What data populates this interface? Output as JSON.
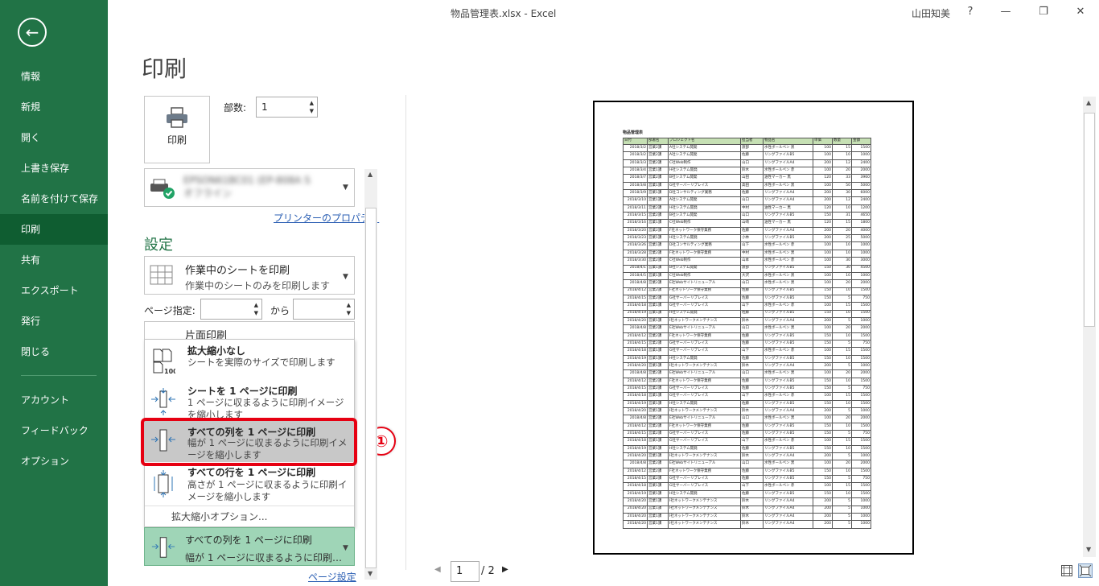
{
  "window": {
    "title": "物品管理表.xlsx  -  Excel",
    "user": "山田知美",
    "help": "?",
    "minimize": "—",
    "restore": "❐",
    "close": "✕"
  },
  "nav": {
    "back": "←",
    "items": [
      "情報",
      "新規",
      "開く",
      "上書き保存",
      "名前を付けて保存",
      "印刷",
      "共有",
      "エクスポート",
      "発行",
      "閉じる"
    ],
    "bottom_items": [
      "アカウント",
      "フィードバック",
      "オプション"
    ],
    "active": "印刷"
  },
  "print": {
    "heading": "印刷",
    "button_label": "印刷",
    "copies_label": "部数:",
    "copies_value": "1",
    "printer_name": "EPSON61BC01 (EP-808A S",
    "printer_status": "オフライン",
    "printer_properties": "プリンターのプロパティ"
  },
  "settings": {
    "heading": "設定",
    "what": {
      "title": "作業中のシートを印刷",
      "desc": "作業中のシートのみを印刷します"
    },
    "pages_label": "ページ指定:",
    "pages_to": "から",
    "sides": {
      "title": "片面印刷"
    },
    "scaling_menu": [
      {
        "title": "拡大縮小なし",
        "desc": "シートを実際のサイズで印刷します"
      },
      {
        "title": "シートを 1 ページに印刷",
        "desc": "1 ページに収まるように印刷イメージを縮小します"
      },
      {
        "title": "すべての列を 1 ページに印刷",
        "desc": "幅が 1 ページに収まるように印刷イメージを縮小します"
      },
      {
        "title": "すべての行を 1 ページに印刷",
        "desc": "高さが 1 ページに収まるように印刷イメージを縮小します"
      }
    ],
    "scaling_options": "拡大縮小オプション...",
    "scaling_selected": {
      "title": "すべての列を 1 ページに印刷",
      "desc": "幅が 1 ページに収まるように印刷…"
    },
    "page_setup": "ページ設定",
    "step_badge": "①"
  },
  "pager": {
    "prev": "◀",
    "current": "1",
    "total": "/ 2",
    "next": "▶"
  },
  "sheet": {
    "title": "物品管理表",
    "headers": [
      "日付",
      "部署名",
      "プロジェクト名",
      "担当者",
      "物品名",
      "単価",
      "数量",
      "金額"
    ],
    "rows": [
      [
        "2018/3/2",
        "営業2課",
        "A社システム開発",
        "渡部",
        "水性ボールペン 黒",
        "100",
        "15",
        "1500"
      ],
      [
        "2018/3/2",
        "営業2課",
        "A社システム開発",
        "佐藤",
        "リングファイルB5",
        "100",
        "10",
        "1000"
      ],
      [
        "2018/3/3",
        "営業2課",
        "C社Web制作",
        "山口",
        "リングファイルA4",
        "200",
        "12",
        "2400"
      ],
      [
        "2018/3/4",
        "営業1課",
        "H社システム開発",
        "鈴木",
        "水性ボールペン 赤",
        "100",
        "20",
        "2000"
      ],
      [
        "2018/3/7",
        "営業2課",
        "B社システム開発",
        "山田",
        "油性マーカー 黒",
        "120",
        "33",
        "3960"
      ],
      [
        "2018/3/8",
        "営業1課",
        "G社サーバーリプレイス",
        "高田",
        "水性ボールペン 黒",
        "100",
        "50",
        "5000"
      ],
      [
        "2018/3/9",
        "営業1課",
        "D社コンサルティング業務",
        "佐藤",
        "リングファイルA4",
        "200",
        "30",
        "6000"
      ],
      [
        "2018/3/10",
        "営業1課",
        "A社システム開発",
        "山口",
        "リングファイルA4",
        "200",
        "12",
        "2400"
      ],
      [
        "2018/3/11",
        "営業2課",
        "H社システム開発",
        "中村",
        "油性マーカー 黒",
        "120",
        "10",
        "1200"
      ],
      [
        "2018/3/15",
        "営業2課",
        "B社システム開発",
        "山口",
        "リングファイルB5",
        "150",
        "31",
        "4650"
      ],
      [
        "2018/3/16",
        "営業1課",
        "C社Web制作",
        "山崎",
        "油性マーカー 黒",
        "120",
        "15",
        "1800"
      ],
      [
        "2018/3/20",
        "営業2課",
        "F社ネットワーク保守業務",
        "佐藤",
        "リングファイルA4",
        "200",
        "20",
        "4000"
      ],
      [
        "2018/3/23",
        "営業1課",
        "H社システム開発",
        "小林",
        "リングファイルB5",
        "200",
        "25",
        "5000"
      ],
      [
        "2018/3/26",
        "営業1課",
        "D社コンサルティング業務",
        "山下",
        "水性ボールペン 赤",
        "100",
        "10",
        "1000"
      ],
      [
        "2018/3/28",
        "営業2課",
        "F社ネットワーク保守業務",
        "中村",
        "水性ボールペン 黒",
        "100",
        "10",
        "1000"
      ],
      [
        "2018/3/30",
        "営業2課",
        "C社Web制作",
        "山本",
        "水性ボールペン 赤",
        "100",
        "30",
        "3000"
      ],
      [
        "2018/4/1",
        "営業1課",
        "B社システム開発",
        "渡部",
        "リングファイルB5",
        "150",
        "30",
        "4500"
      ],
      [
        "2018/4/5",
        "営業1課",
        "C社Web制作",
        "大沢",
        "水性ボールペン 黒",
        "100",
        "10",
        "1000"
      ],
      [
        "2018/4/8",
        "営業2課",
        "E社Webサイトリニューアル",
        "山口",
        "水性ボールペン 黒",
        "100",
        "20",
        "2000"
      ],
      [
        "2018/4/12",
        "営業2課",
        "F社ネットワーク保守業務",
        "佐藤",
        "リングファイルB5",
        "150",
        "10",
        "1500"
      ],
      [
        "2018/4/15",
        "営業2課",
        "G社サーバーリプレイス",
        "佐藤",
        "リングファイルB5",
        "150",
        "5",
        "750"
      ],
      [
        "2018/4/18",
        "営業1課",
        "G社サーバーリプレイス",
        "山下",
        "水性ボールペン 赤",
        "100",
        "15",
        "1500"
      ],
      [
        "2018/4/19",
        "営業1課",
        "H社システム開発",
        "佐藤",
        "リングファイルB5",
        "150",
        "10",
        "1500"
      ],
      [
        "2018/4/20",
        "営業1課",
        "I社ネットワークメンテナンス",
        "鈴木",
        "リングファイルA4",
        "200",
        "5",
        "1000"
      ],
      [
        "2018/4/8",
        "営業2課",
        "E社Webサイトリニューアル",
        "山口",
        "水性ボールペン 黒",
        "100",
        "20",
        "2000"
      ],
      [
        "2018/4/12",
        "営業2課",
        "F社ネットワーク保守業務",
        "佐藤",
        "リングファイルB5",
        "150",
        "10",
        "1500"
      ],
      [
        "2018/4/15",
        "営業2課",
        "G社サーバーリプレイス",
        "佐藤",
        "リングファイルB5",
        "150",
        "5",
        "750"
      ],
      [
        "2018/4/18",
        "営業1課",
        "G社サーバーリプレイス",
        "山下",
        "水性ボールペン 赤",
        "100",
        "15",
        "1500"
      ],
      [
        "2018/4/19",
        "営業1課",
        "H社システム開発",
        "佐藤",
        "リングファイルB5",
        "150",
        "10",
        "1500"
      ],
      [
        "2018/4/20",
        "営業1課",
        "I社ネットワークメンテナンス",
        "鈴木",
        "リングファイルA4",
        "200",
        "5",
        "1000"
      ],
      [
        "2018/4/8",
        "営業2課",
        "E社Webサイトリニューアル",
        "山口",
        "水性ボールペン 黒",
        "100",
        "20",
        "2000"
      ],
      [
        "2018/4/12",
        "営業2課",
        "F社ネットワーク保守業務",
        "佐藤",
        "リングファイルB5",
        "150",
        "10",
        "1500"
      ],
      [
        "2018/4/15",
        "営業2課",
        "G社サーバーリプレイス",
        "佐藤",
        "リングファイルB5",
        "150",
        "5",
        "750"
      ],
      [
        "2018/4/18",
        "営業1課",
        "G社サーバーリプレイス",
        "山下",
        "水性ボールペン 赤",
        "100",
        "15",
        "1500"
      ],
      [
        "2018/4/19",
        "営業1課",
        "H社システム開発",
        "佐藤",
        "リングファイルB5",
        "150",
        "10",
        "1500"
      ],
      [
        "2018/4/20",
        "営業1課",
        "I社ネットワークメンテナンス",
        "鈴木",
        "リングファイルA4",
        "200",
        "5",
        "1000"
      ],
      [
        "2018/4/8",
        "営業2課",
        "E社Webサイトリニューアル",
        "山口",
        "水性ボールペン 黒",
        "100",
        "20",
        "2000"
      ],
      [
        "2018/4/12",
        "営業2課",
        "F社ネットワーク保守業務",
        "佐藤",
        "リングファイルB5",
        "150",
        "10",
        "1500"
      ],
      [
        "2018/4/15",
        "営業2課",
        "G社サーバーリプレイス",
        "佐藤",
        "リングファイルB5",
        "150",
        "5",
        "750"
      ],
      [
        "2018/4/18",
        "営業1課",
        "G社サーバーリプレイス",
        "山下",
        "水性ボールペン 赤",
        "100",
        "15",
        "1500"
      ],
      [
        "2018/4/19",
        "営業1課",
        "H社システム開発",
        "佐藤",
        "リングファイルB5",
        "150",
        "10",
        "1500"
      ],
      [
        "2018/4/20",
        "営業1課",
        "I社ネットワークメンテナンス",
        "鈴木",
        "リングファイルA4",
        "200",
        "5",
        "1000"
      ],
      [
        "2018/4/8",
        "営業2課",
        "E社Webサイトリニューアル",
        "山口",
        "水性ボールペン 黒",
        "100",
        "20",
        "2000"
      ],
      [
        "2018/4/12",
        "営業2課",
        "F社ネットワーク保守業務",
        "佐藤",
        "リングファイルB5",
        "150",
        "10",
        "1500"
      ],
      [
        "2018/4/15",
        "営業2課",
        "G社サーバーリプレイス",
        "佐藤",
        "リングファイルB5",
        "150",
        "5",
        "750"
      ],
      [
        "2018/4/18",
        "営業1課",
        "G社サーバーリプレイス",
        "山下",
        "水性ボールペン 赤",
        "100",
        "15",
        "1500"
      ],
      [
        "2018/4/19",
        "営業1課",
        "H社システム開発",
        "佐藤",
        "リングファイルB5",
        "150",
        "10",
        "1500"
      ],
      [
        "2018/4/20",
        "営業1課",
        "I社ネットワークメンテナンス",
        "鈴木",
        "リングファイルA4",
        "200",
        "5",
        "1000"
      ],
      [
        "2018/4/20",
        "営業1課",
        "I社ネットワークメンテナンス",
        "鈴木",
        "リングファイルA4",
        "200",
        "5",
        "1000"
      ],
      [
        "2018/4/20",
        "営業1課",
        "I社ネットワークメンテナンス",
        "鈴木",
        "リングファイルA4",
        "200",
        "5",
        "1000"
      ],
      [
        "2018/4/20",
        "営業1課",
        "I社ネットワークメンテナンス",
        "鈴木",
        "リングファイルA4",
        "200",
        "5",
        "1000"
      ]
    ]
  },
  "colors": {
    "nav_bg": "#217346",
    "nav_active": "#0f5d31",
    "accent_green": "#217346",
    "highlight_red": "#e60012",
    "header_green": "#c6e0b4"
  }
}
